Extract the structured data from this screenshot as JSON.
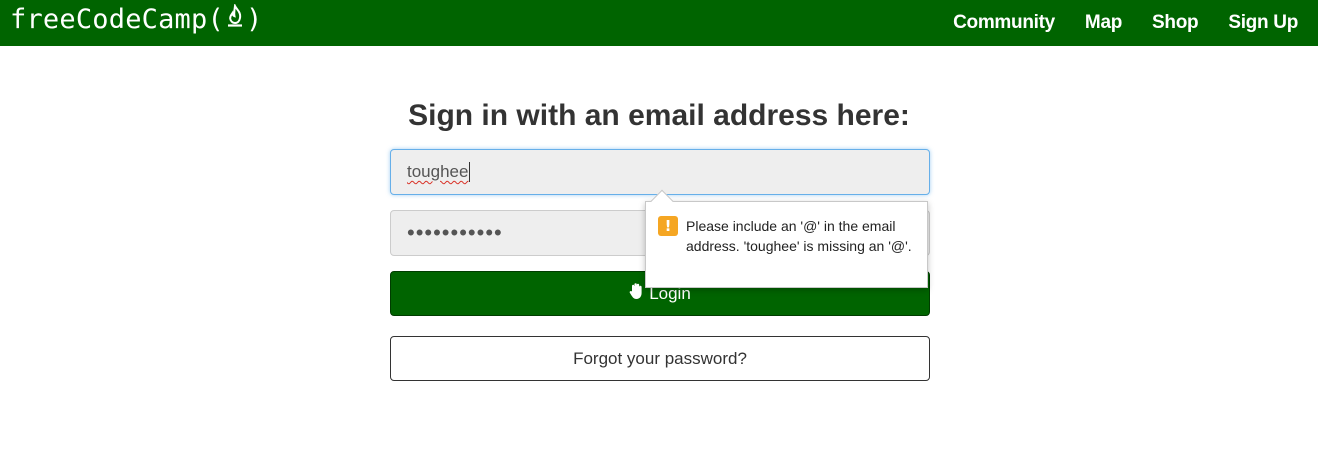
{
  "navbar": {
    "brand_text": "freeCodeCamp",
    "brand_open": "(",
    "brand_close": ")",
    "links": [
      "Community",
      "Map",
      "Shop",
      "Sign Up"
    ]
  },
  "form": {
    "title": "Sign in with an email address here:",
    "email_value": "toughee",
    "password_value": "•••••••••••",
    "login_label": "Login",
    "forgot_label": "Forgot your password?"
  },
  "validation": {
    "icon": "!",
    "message": "Please include an '@' in the email address. 'toughee' is missing an '@'."
  },
  "colors": {
    "brand_green": "#006400",
    "warning": "#f5a623",
    "focus_border": "#66afe9"
  },
  "icons": {
    "brand": "flame-icon",
    "login": "hand-icon",
    "validation": "warning-icon"
  }
}
